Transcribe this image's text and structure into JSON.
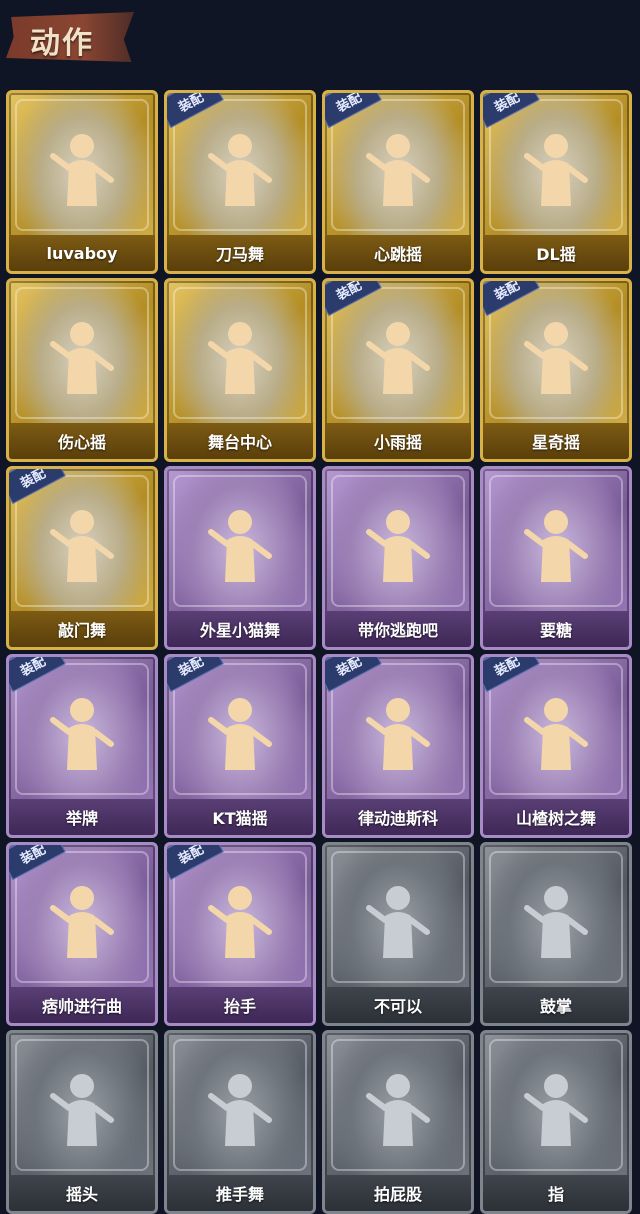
{
  "page": {
    "title": "动作"
  },
  "badge_label": "装配",
  "colors": {
    "gold": "#d8b248",
    "purple": "#a88bc6",
    "grey": "#7f858d",
    "badge": "#2b3b6b",
    "figure": "#f3d7aa"
  },
  "actions": [
    {
      "label": "luvaboy",
      "tier": "gold",
      "equipped": false
    },
    {
      "label": "刀马舞",
      "tier": "gold",
      "equipped": true
    },
    {
      "label": "心跳摇",
      "tier": "gold",
      "equipped": true
    },
    {
      "label": "DL摇",
      "tier": "gold",
      "equipped": true
    },
    {
      "label": "伤心摇",
      "tier": "gold",
      "equipped": false
    },
    {
      "label": "舞台中心",
      "tier": "gold",
      "equipped": false
    },
    {
      "label": "小雨摇",
      "tier": "gold",
      "equipped": true
    },
    {
      "label": "星奇摇",
      "tier": "gold",
      "equipped": true
    },
    {
      "label": "敲门舞",
      "tier": "gold",
      "equipped": true
    },
    {
      "label": "外星小猫舞",
      "tier": "purple",
      "equipped": false
    },
    {
      "label": "带你逃跑吧",
      "tier": "purple",
      "equipped": false
    },
    {
      "label": "要糖",
      "tier": "purple",
      "equipped": false
    },
    {
      "label": "举牌",
      "tier": "purple",
      "equipped": true
    },
    {
      "label": "KT猫摇",
      "tier": "purple",
      "equipped": true
    },
    {
      "label": "律动迪斯科",
      "tier": "purple",
      "equipped": true
    },
    {
      "label": "山楂树之舞",
      "tier": "purple",
      "equipped": true
    },
    {
      "label": "痞帅进行曲",
      "tier": "purple",
      "equipped": true
    },
    {
      "label": "抬手",
      "tier": "purple",
      "equipped": true
    },
    {
      "label": "不可以",
      "tier": "grey",
      "equipped": false
    },
    {
      "label": "鼓掌",
      "tier": "grey",
      "equipped": false
    },
    {
      "label": "摇头",
      "tier": "grey",
      "equipped": false
    },
    {
      "label": "推手舞",
      "tier": "grey",
      "equipped": false
    },
    {
      "label": "拍屁股",
      "tier": "grey",
      "equipped": false
    },
    {
      "label": "指",
      "tier": "grey",
      "equipped": false
    }
  ]
}
